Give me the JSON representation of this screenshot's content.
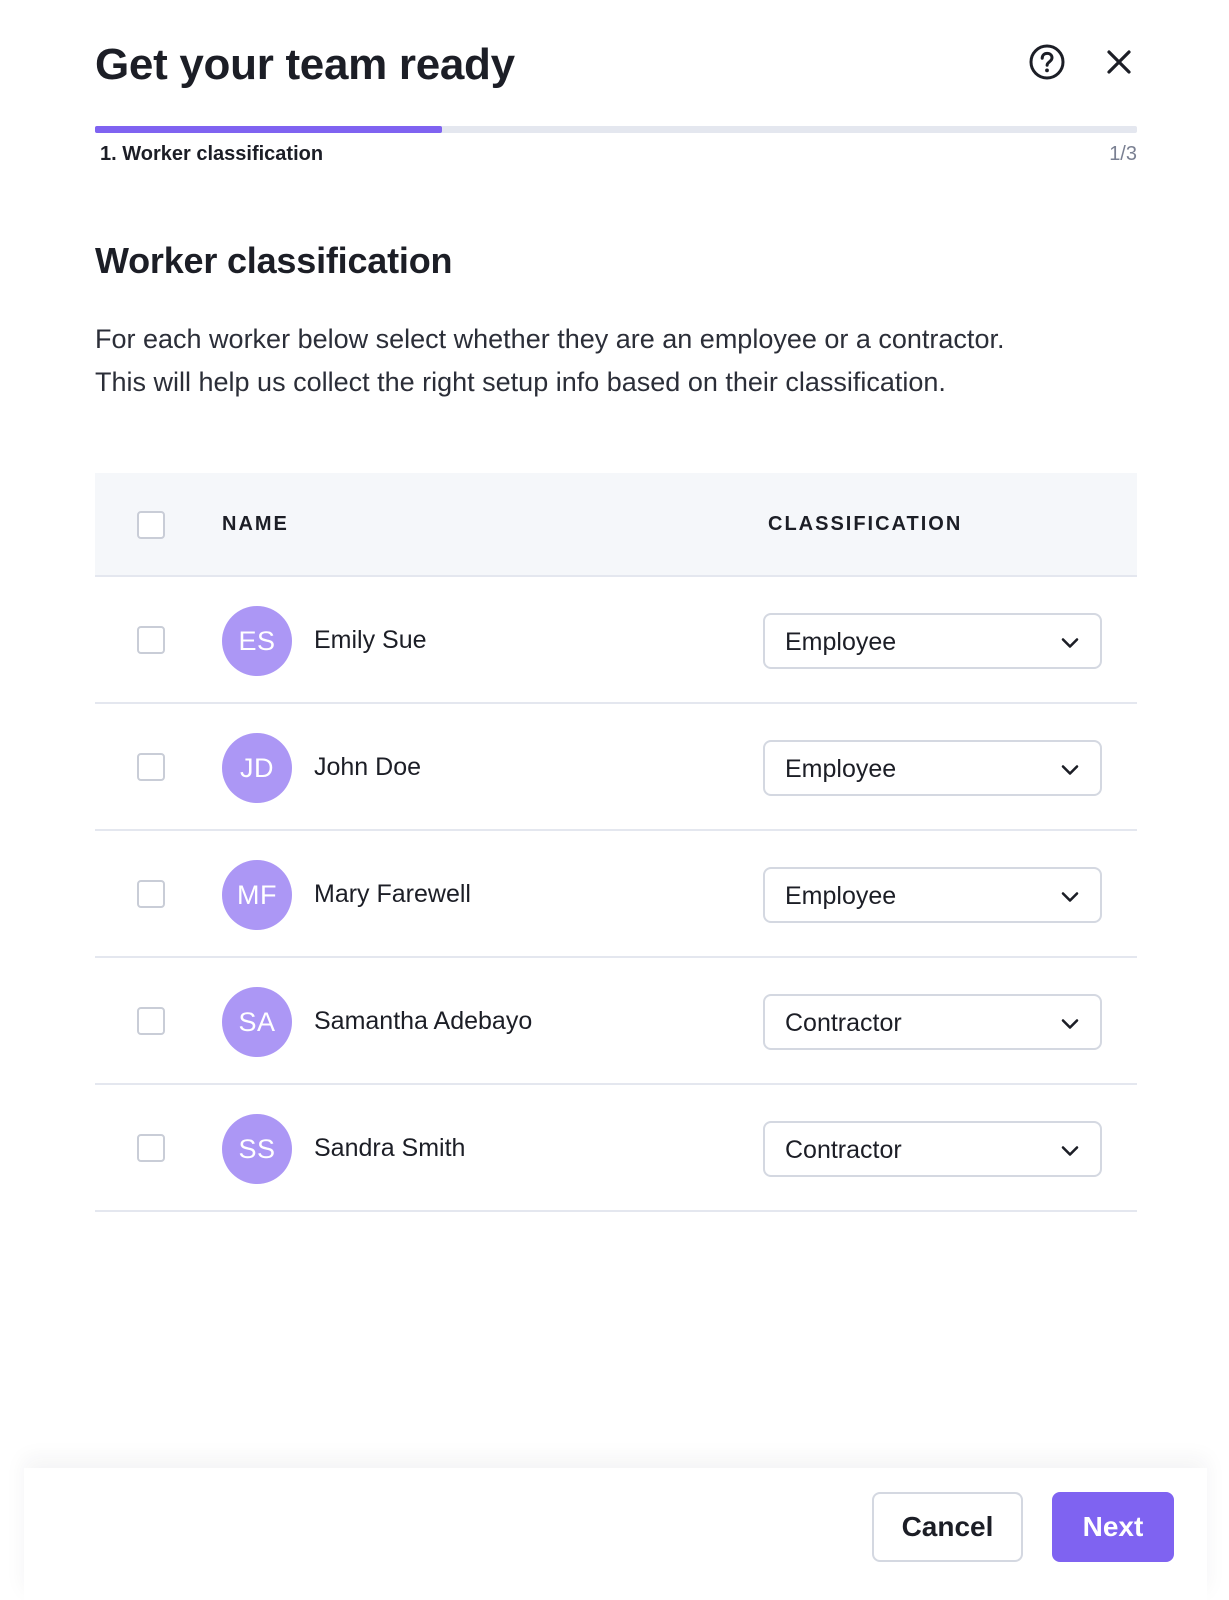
{
  "header": {
    "title": "Get your team ready",
    "help_icon": "help-circle-icon",
    "close_icon": "close-icon"
  },
  "progress": {
    "step_label": "1. Worker classification",
    "step_count": "1/3",
    "fraction": 0.333,
    "accent_color": "#7f63f1"
  },
  "section": {
    "title": "Worker classification",
    "description_line1": "For each worker below select whether they are an employee or a contractor.",
    "description_line2": "This will help us collect the right setup info based on their classification."
  },
  "table": {
    "columns": {
      "name": "NAME",
      "classification": "CLASSIFICATION"
    },
    "rows": [
      {
        "initials": "ES",
        "name": "Emily Sue",
        "classification": "Employee"
      },
      {
        "initials": "JD",
        "name": "John Doe",
        "classification": "Employee"
      },
      {
        "initials": "MF",
        "name": "Mary Farewell",
        "classification": "Employee"
      },
      {
        "initials": "SA",
        "name": "Samantha Adebayo",
        "classification": "Contractor"
      },
      {
        "initials": "SS",
        "name": "Sandra Smith",
        "classification": "Contractor"
      }
    ]
  },
  "footer": {
    "cancel_label": "Cancel",
    "next_label": "Next"
  }
}
